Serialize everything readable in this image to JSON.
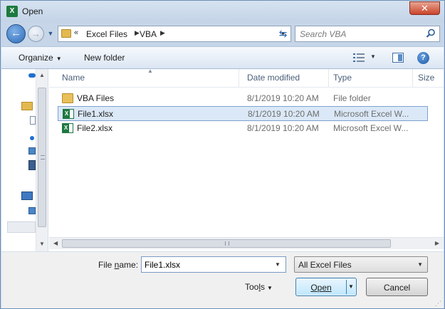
{
  "window": {
    "title": "Open",
    "app_icon": "excel-icon",
    "close_label": "✕"
  },
  "address_bar": {
    "overflow_chevron": "«",
    "crumbs": [
      "Excel Files",
      "VBA"
    ],
    "separator": "▶"
  },
  "search": {
    "placeholder": "Search VBA",
    "value": ""
  },
  "toolbar": {
    "organize_label": "Organize",
    "new_folder_label": "New folder"
  },
  "columns": {
    "name": "Name",
    "date_modified": "Date modified",
    "type": "Type",
    "size": "Size"
  },
  "files": [
    {
      "name": "VBA Files",
      "date": "8/1/2019 10:20 AM",
      "type": "File folder",
      "icon": "folder-icon",
      "selected": false
    },
    {
      "name": "File1.xlsx",
      "date": "8/1/2019 10:20 AM",
      "type": "Microsoft Excel W...",
      "icon": "excel-file-icon",
      "selected": true
    },
    {
      "name": "File2.xlsx",
      "date": "8/1/2019 10:20 AM",
      "type": "Microsoft Excel W...",
      "icon": "excel-file-icon",
      "selected": false
    }
  ],
  "bottom": {
    "file_name_label_pre": "File ",
    "file_name_label_u": "n",
    "file_name_label_post": "ame:",
    "file_name_value": "File1.xlsx",
    "filter_value": "All Excel Files",
    "tools_label_pre": "Too",
    "tools_label_u": "l",
    "tools_label_post": "s",
    "open_label": "Open",
    "cancel_label": "Cancel"
  },
  "colors": {
    "selection_bg": "#dbe8f7",
    "selection_border": "#7da2ce",
    "accent": "#2d6bb6"
  }
}
